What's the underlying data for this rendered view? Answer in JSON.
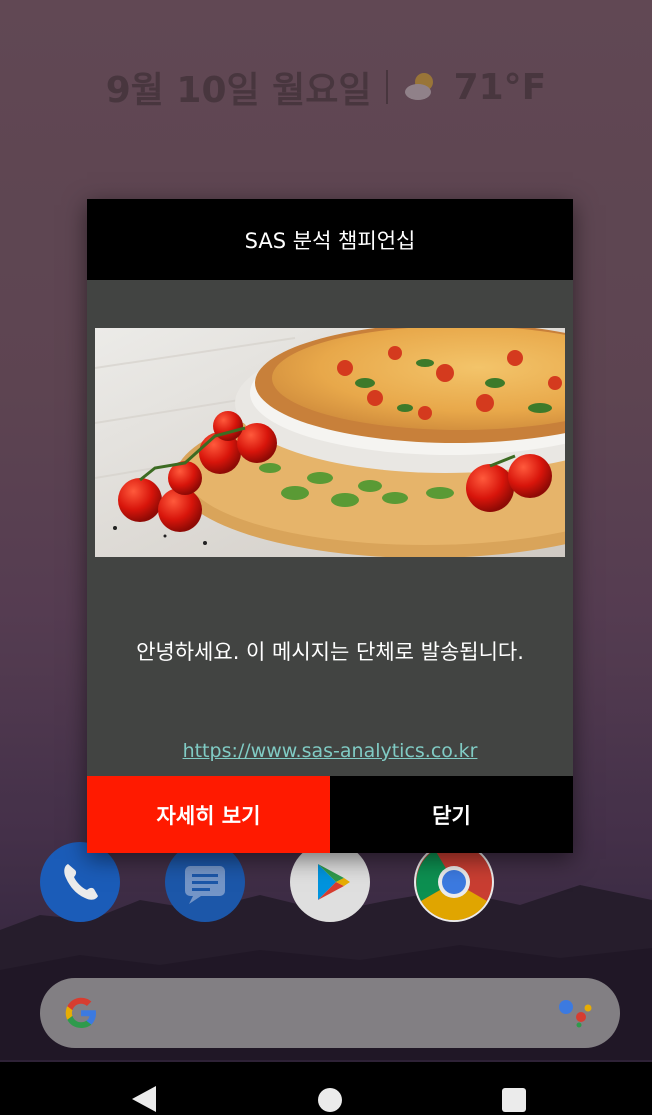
{
  "status_widget": {
    "date": "9월 10일 월요일",
    "temperature": "71°F",
    "weather_icon": "partly-cloudy-icon"
  },
  "dialog": {
    "title": "SAS 분석 챔피언십",
    "image_description": "pizza-image",
    "message": "안녕하세요. 이 메시지는 단체로 발송됩니다.",
    "link": "https://www.sas-analytics.co.kr",
    "detail_button_label": "자세히 보기",
    "close_button_label": "닫기"
  },
  "dock": {
    "apps": [
      "phone-icon",
      "messages-icon",
      "play-store-icon",
      "chrome-icon"
    ]
  },
  "search_bar": {
    "logo": "google-logo-icon",
    "assistant": "assistant-icon"
  },
  "navbar": {
    "buttons": [
      "back-icon",
      "home-icon",
      "recents-icon"
    ]
  },
  "colors": {
    "dialog_body": "#424442",
    "dialog_header": "#000000",
    "detail_button": "#ff1a00",
    "close_button": "#000000",
    "link": "#80cbc4"
  }
}
